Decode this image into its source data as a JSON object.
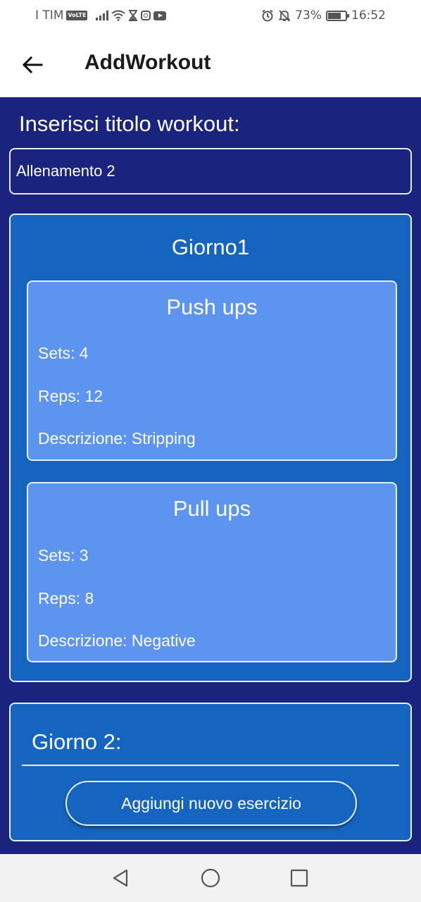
{
  "status_bar": {
    "carrier": "I TIM",
    "volte": "VoLTE",
    "battery_percent": "73%",
    "battery_level": 0.73,
    "time": "16:52"
  },
  "app_bar": {
    "title": "AddWorkout"
  },
  "workout": {
    "title_label": "Inserisci titolo workout:",
    "title_value": "Allenamento 2"
  },
  "days": [
    {
      "title": "Giorno1",
      "exercises": [
        {
          "name": "Push ups",
          "sets": "Sets: 4",
          "reps": "Reps: 12",
          "description": "Descrizione: Stripping"
        },
        {
          "name": "Pull ups",
          "sets": "Sets: 3",
          "reps": "Reps: 8",
          "description": "Descrizione: Negative"
        }
      ]
    },
    {
      "title": "Giorno 2:",
      "add_button": "Aggiungi nuovo esercizio"
    }
  ],
  "colors": {
    "content_bg": "#1a237e",
    "day_card_bg": "#1565c0",
    "exercise_card_bg": "#5c94f0"
  }
}
